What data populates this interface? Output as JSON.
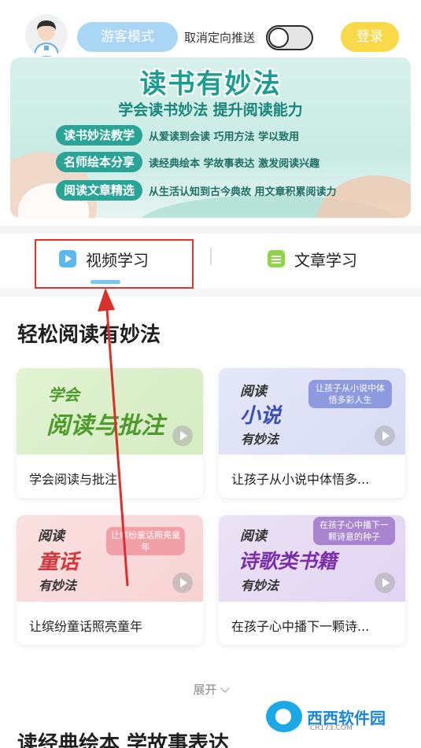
{
  "header": {
    "guest_label": "游客模式",
    "push_label": "取消定向推送",
    "login_label": "登录"
  },
  "banner": {
    "title": "读书有妙法",
    "subtitle": "学会读书妙法 提升阅读能力",
    "rows": [
      {
        "pill": "读书妙法教学",
        "desc": "从爱读到会读 巧用方法 学以致用"
      },
      {
        "pill": "名师绘本分享",
        "desc": "读经典绘本 学故事表达 激发阅读兴趣"
      },
      {
        "pill": "阅读文章精选",
        "desc": "从生活认知到古今典故 用文章积累阅读力"
      }
    ]
  },
  "tabs": {
    "video": "视频学习",
    "article": "文章学习"
  },
  "section": {
    "title": "轻松阅读有妙法",
    "cards": [
      {
        "small": "学会",
        "big": "阅读与批注",
        "caption": "学会阅读与批注",
        "bubble": "",
        "big_color": "#4f9a2c"
      },
      {
        "small": "阅读",
        "big": "小说",
        "small2": "有妙法",
        "caption": "让孩子从小说中体悟多...",
        "bubble": "让孩子从小说中体悟多彩人生",
        "big_color": "#3a4fb0",
        "bubble_color": "#8e9ae0"
      },
      {
        "small": "阅读",
        "big": "童话",
        "small2": "有妙法",
        "caption": "让缤纷童话照亮童年",
        "bubble": "让缤纷童话照亮童年",
        "big_color": "#d2373d",
        "bubble_color": "#f0a0a6"
      },
      {
        "small": "阅读",
        "big": "诗歌类书籍",
        "small2": "有妙法",
        "caption": "在孩子心中播下一颗诗...",
        "bubble": "在孩子心中播下一颗诗意的种子",
        "big_color": "#7a2fa8",
        "bubble_color": "#a984cf"
      }
    ]
  },
  "expand_label": "展开",
  "section2_title": "读经典绘本 学故事表达",
  "watermark": {
    "text": "西西软件园",
    "sub": "CR173.COM"
  }
}
